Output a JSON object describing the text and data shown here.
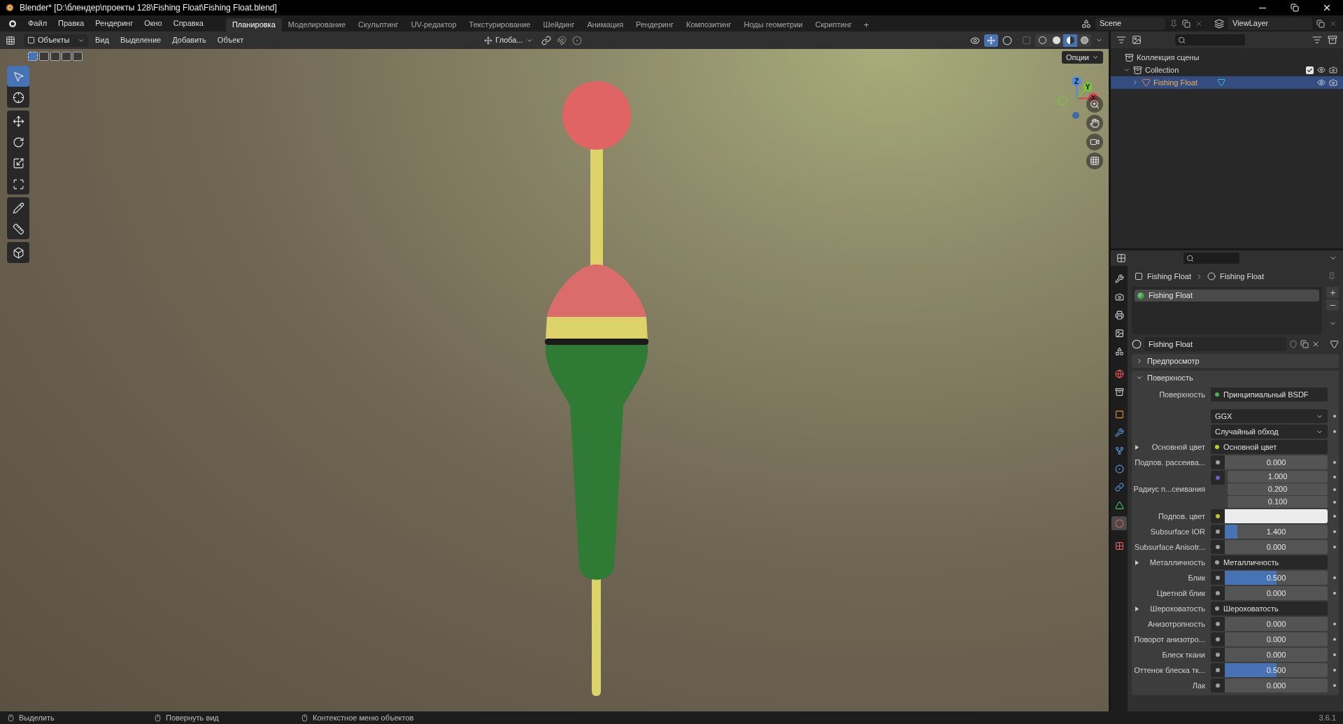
{
  "window": {
    "title": "Blender* [D:\\блендер\\проекты 128\\Fishing Float\\Fishing Float.blend]"
  },
  "menu": [
    "Файл",
    "Правка",
    "Рендеринг",
    "Окно",
    "Справка"
  ],
  "workspaces": [
    {
      "label": "Планировка",
      "selected": true
    },
    {
      "label": "Моделирование",
      "selected": false
    },
    {
      "label": "Скульптинг",
      "selected": false
    },
    {
      "label": "UV-редактор",
      "selected": false
    },
    {
      "label": "Текстурирование",
      "selected": false
    },
    {
      "label": "Шейдинг",
      "selected": false
    },
    {
      "label": "Анимация",
      "selected": false
    },
    {
      "label": "Рендеринг",
      "selected": false
    },
    {
      "label": "Композитинг",
      "selected": false
    },
    {
      "label": "Ноды геометрии",
      "selected": false
    },
    {
      "label": "Скриптинг",
      "selected": false
    }
  ],
  "add_workspace": "+",
  "scene": {
    "name": "Scene"
  },
  "view_layer": {
    "name": "ViewLayer"
  },
  "viewport": {
    "mode": "Объекты",
    "menu": [
      "Вид",
      "Выделение",
      "Добавить",
      "Объект"
    ],
    "orientation": "Глоба...",
    "options": "Опции",
    "gizmo_axes": [
      "X",
      "Y",
      "Z"
    ],
    "select_modes": [
      {
        "selected": true
      },
      {
        "selected": false
      },
      {
        "selected": false
      },
      {
        "selected": false
      },
      {
        "selected": false
      }
    ],
    "shading": [
      {
        "kind": "wire",
        "selected": false
      },
      {
        "kind": "solid",
        "selected": false
      },
      {
        "kind": "material",
        "selected": true
      },
      {
        "kind": "rendered",
        "selected": false
      }
    ],
    "tools": [
      {
        "kind": "select",
        "selected": true
      },
      {
        "kind": "cursor",
        "selected": false
      },
      {
        "kind": "move",
        "selected": false
      },
      {
        "kind": "rotate",
        "selected": false
      },
      {
        "kind": "scale",
        "selected": false
      },
      {
        "kind": "transform",
        "selected": false
      },
      {
        "kind": "annotate",
        "selected": false
      },
      {
        "kind": "measure",
        "selected": false
      },
      {
        "kind": "add_cube",
        "selected": false
      }
    ]
  },
  "outliner": {
    "items": [
      {
        "label": "Коллекция сцены",
        "children": [
          {
            "label": "Collection",
            "expanded": true,
            "checked": true,
            "children": [
              {
                "label": "Fishing Float",
                "expanded": false,
                "selected": true
              }
            ]
          }
        ]
      }
    ]
  },
  "properties": {
    "tabs": [
      {
        "kind": "tool",
        "selected": false
      },
      {
        "kind": "render",
        "selected": false
      },
      {
        "kind": "output",
        "selected": false
      },
      {
        "kind": "view_layer",
        "selected": false
      },
      {
        "kind": "scene",
        "selected": false
      },
      {
        "kind": "world",
        "selected": false
      },
      {
        "kind": "collection",
        "selected": false
      },
      {
        "kind": "object",
        "selected": false
      },
      {
        "kind": "modifiers",
        "selected": false
      },
      {
        "kind": "particles",
        "selected": false
      },
      {
        "kind": "physics",
        "selected": false
      },
      {
        "kind": "constraints",
        "selected": false
      },
      {
        "kind": "data",
        "selected": false
      },
      {
        "kind": "material",
        "selected": true
      },
      {
        "kind": "texture",
        "selected": false
      }
    ],
    "breadcrumb": [
      "Fishing Float",
      "Fishing Float"
    ],
    "slots": [
      {
        "label": "Fishing Float",
        "selected": true
      }
    ],
    "material": "Fishing Float",
    "panels": [
      {
        "label": "Предпросмотр",
        "expanded": false
      },
      {
        "label": "Поверхность",
        "expanded": true,
        "rows": [
          {
            "kind": "shader",
            "label": "Поверхность",
            "value": "Принципиальный BSDF",
            "color": "#4cb04c"
          },
          {
            "kind": "dropdown",
            "value": "GGX"
          },
          {
            "kind": "dropdown",
            "value": "Случайный обход"
          },
          {
            "kind": "input",
            "label": "Основной цвет",
            "value": "Основной цвет",
            "color": "#c7c729",
            "expanded": false
          },
          {
            "kind": "slider",
            "label": "Подпов. рассеива...",
            "value": "0.000",
            "level": 0,
            "color": "#a1a1a1"
          },
          {
            "kind": "vector",
            "label": "Радиус п...сеивания",
            "values": [
              "1.000",
              "0.200",
              "0.100"
            ],
            "color": "#6363c7"
          },
          {
            "kind": "color",
            "label": "Подпов. цвет",
            "color": "#c7c729"
          },
          {
            "kind": "slider",
            "label": "Subsurface IOR",
            "value": "1.400",
            "level": 0.12,
            "color": "#a1a1a1"
          },
          {
            "kind": "slider",
            "label": "Subsurface Anisotr...",
            "value": "0.000",
            "level": 0,
            "color": "#a1a1a1"
          },
          {
            "kind": "input",
            "label": "Металличность",
            "value": "Металличность",
            "color": "#a1a1a1",
            "expanded": false
          },
          {
            "kind": "slider",
            "label": "Блик",
            "value": "0.500",
            "level": 0.5,
            "color": "#a1a1a1"
          },
          {
            "kind": "slider",
            "label": "Цветной блик",
            "value": "0.000",
            "level": 0,
            "color": "#a1a1a1"
          },
          {
            "kind": "input",
            "label": "Шероховатость",
            "value": "Шероховатость",
            "color": "#a1a1a1",
            "expanded": false
          },
          {
            "kind": "slider",
            "label": "Анизотропность",
            "value": "0.000",
            "level": 0,
            "color": "#a1a1a1"
          },
          {
            "kind": "slider",
            "label": "Поворот анизотро...",
            "value": "0.000",
            "level": 0,
            "color": "#a1a1a1"
          },
          {
            "kind": "slider",
            "label": "Блеск ткани",
            "value": "0.000",
            "level": 0,
            "color": "#a1a1a1"
          },
          {
            "kind": "slider",
            "label": "Оттенок блеска тк...",
            "value": "0.500",
            "level": 0.5,
            "color": "#a1a1a1"
          },
          {
            "kind": "slider",
            "label": "Лак",
            "value": "0.000",
            "level": 0,
            "color": "#a1a1a1"
          }
        ]
      }
    ]
  },
  "status_bar": {
    "hints": [
      "Выделить",
      "Повернуть вид",
      "Контекстное меню объектов"
    ],
    "version": "3.6.1"
  }
}
